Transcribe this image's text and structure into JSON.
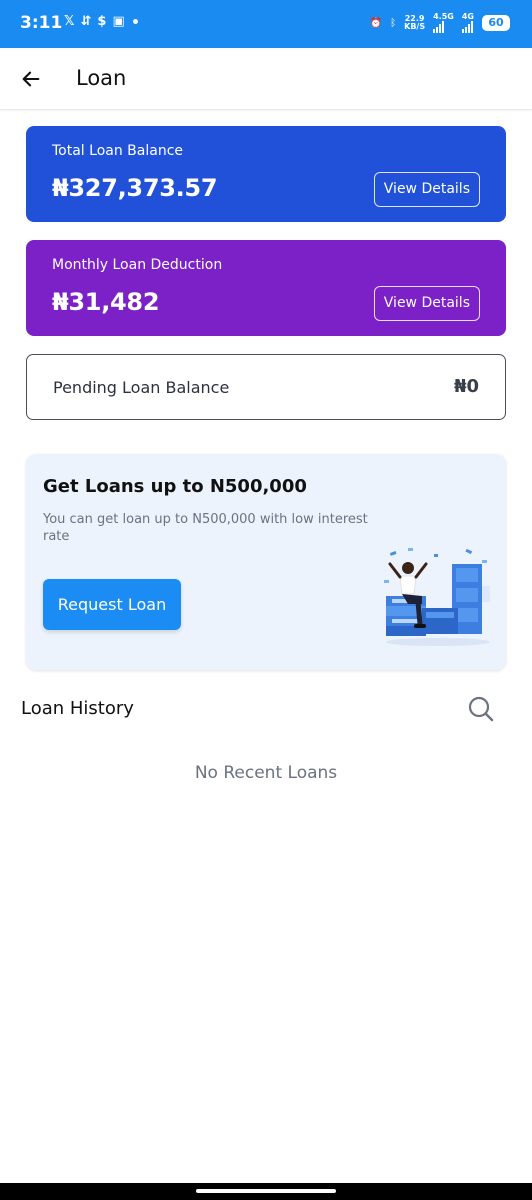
{
  "status_bar": {
    "time": "3:11",
    "left_icons": [
      "x-icon",
      "sync-icon",
      "dollar-icon",
      "game-icon"
    ],
    "net_speed": "22.9",
    "net_unit": "KB/S",
    "net_type_1": "4.5G",
    "net_type_2": "4G",
    "battery": "60"
  },
  "app_bar": {
    "title": "Loan",
    "back_icon": "arrow-left-icon"
  },
  "cards": [
    {
      "label": "Total Loan Balance",
      "amount": "₦327,373.57",
      "button": "View Details",
      "color": "#2151d8"
    },
    {
      "label": "Monthly Loan Deduction",
      "amount": "₦31,482",
      "button": "View Details",
      "color": "#7c21c8"
    }
  ],
  "pending": {
    "label": "Pending Loan Balance",
    "amount": "₦0"
  },
  "promo": {
    "title": "Get Loans up to N500,000",
    "description": "You can get loan up to N500,000 with low interest rate",
    "button": "Request Loan",
    "button_color": "#1b8cf4"
  },
  "history": {
    "title": "Loan History",
    "empty_message": "No Recent Loans"
  },
  "colors": {
    "status_bar": "#1a8bf0",
    "accent": "#1b8cf4"
  }
}
